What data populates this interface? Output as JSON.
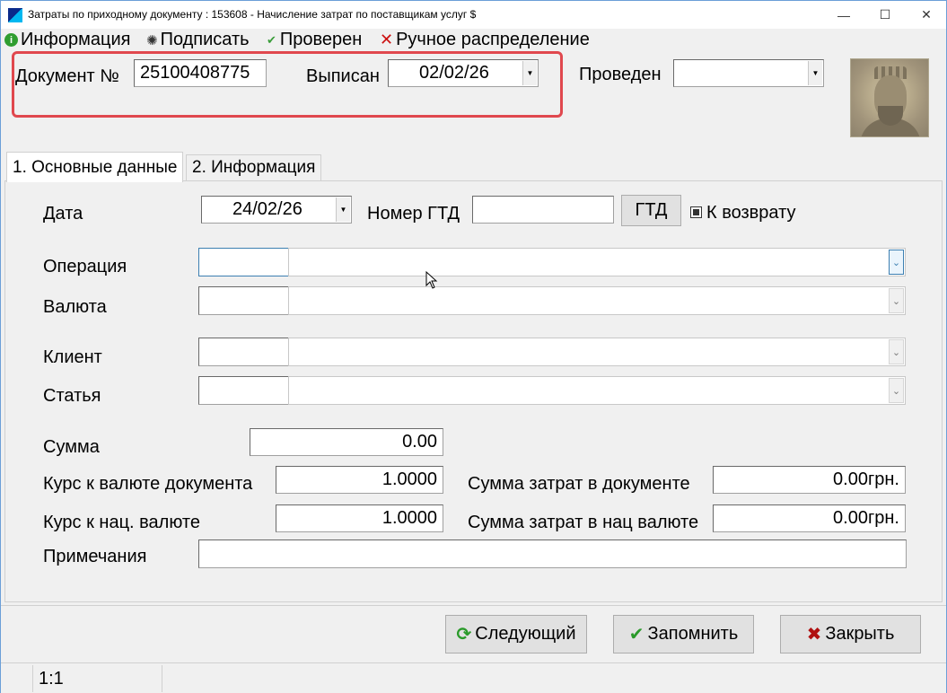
{
  "window": {
    "title": "Затраты по приходному документу : 153608 - Начисление затрат по поставщикам услуг $",
    "minimize": "—",
    "maximize": "☐",
    "close": "✕"
  },
  "menu": {
    "info": "Информация",
    "sign": "Подписать",
    "checked": "Проверен",
    "manual": "Ручное распределение"
  },
  "header": {
    "doc_label": "Документ №",
    "doc_number": "25100408775",
    "issued_label": "Выписан",
    "issued_date": "02/02/26",
    "posted_label": "Проведен",
    "posted_value": ""
  },
  "tabs": [
    {
      "label": "1. Основные данные",
      "active": true
    },
    {
      "label": "2. Информация",
      "active": false
    }
  ],
  "form": {
    "date_label": "Дата",
    "date_value": "24/02/26",
    "gtd_label": "Номер ГТД",
    "gtd_value": "",
    "gtd_button": "ГТД",
    "return_label": "К возврату",
    "operation_label": "Операция",
    "currency_label": "Валюта",
    "client_label": "Клиент",
    "article_label": "Статья",
    "sum_label": "Сумма",
    "sum_value": "0.00",
    "rate_doc_label": "Курс к валюте документа",
    "rate_doc_value": "1.0000",
    "rate_nat_label": "Курс к нац. валюте",
    "rate_nat_value": "1.0000",
    "cost_doc_label": "Сумма затрат в документе",
    "cost_doc_value": "0.00грн.",
    "cost_nat_label": "Сумма затрат в нац валюте",
    "cost_nat_value": "0.00грн.",
    "notes_label": "Примечания",
    "notes_value": ""
  },
  "buttons": {
    "next": "Следующий",
    "save": "Запомнить",
    "close": "Закрыть"
  },
  "status": {
    "position": "1:1"
  }
}
